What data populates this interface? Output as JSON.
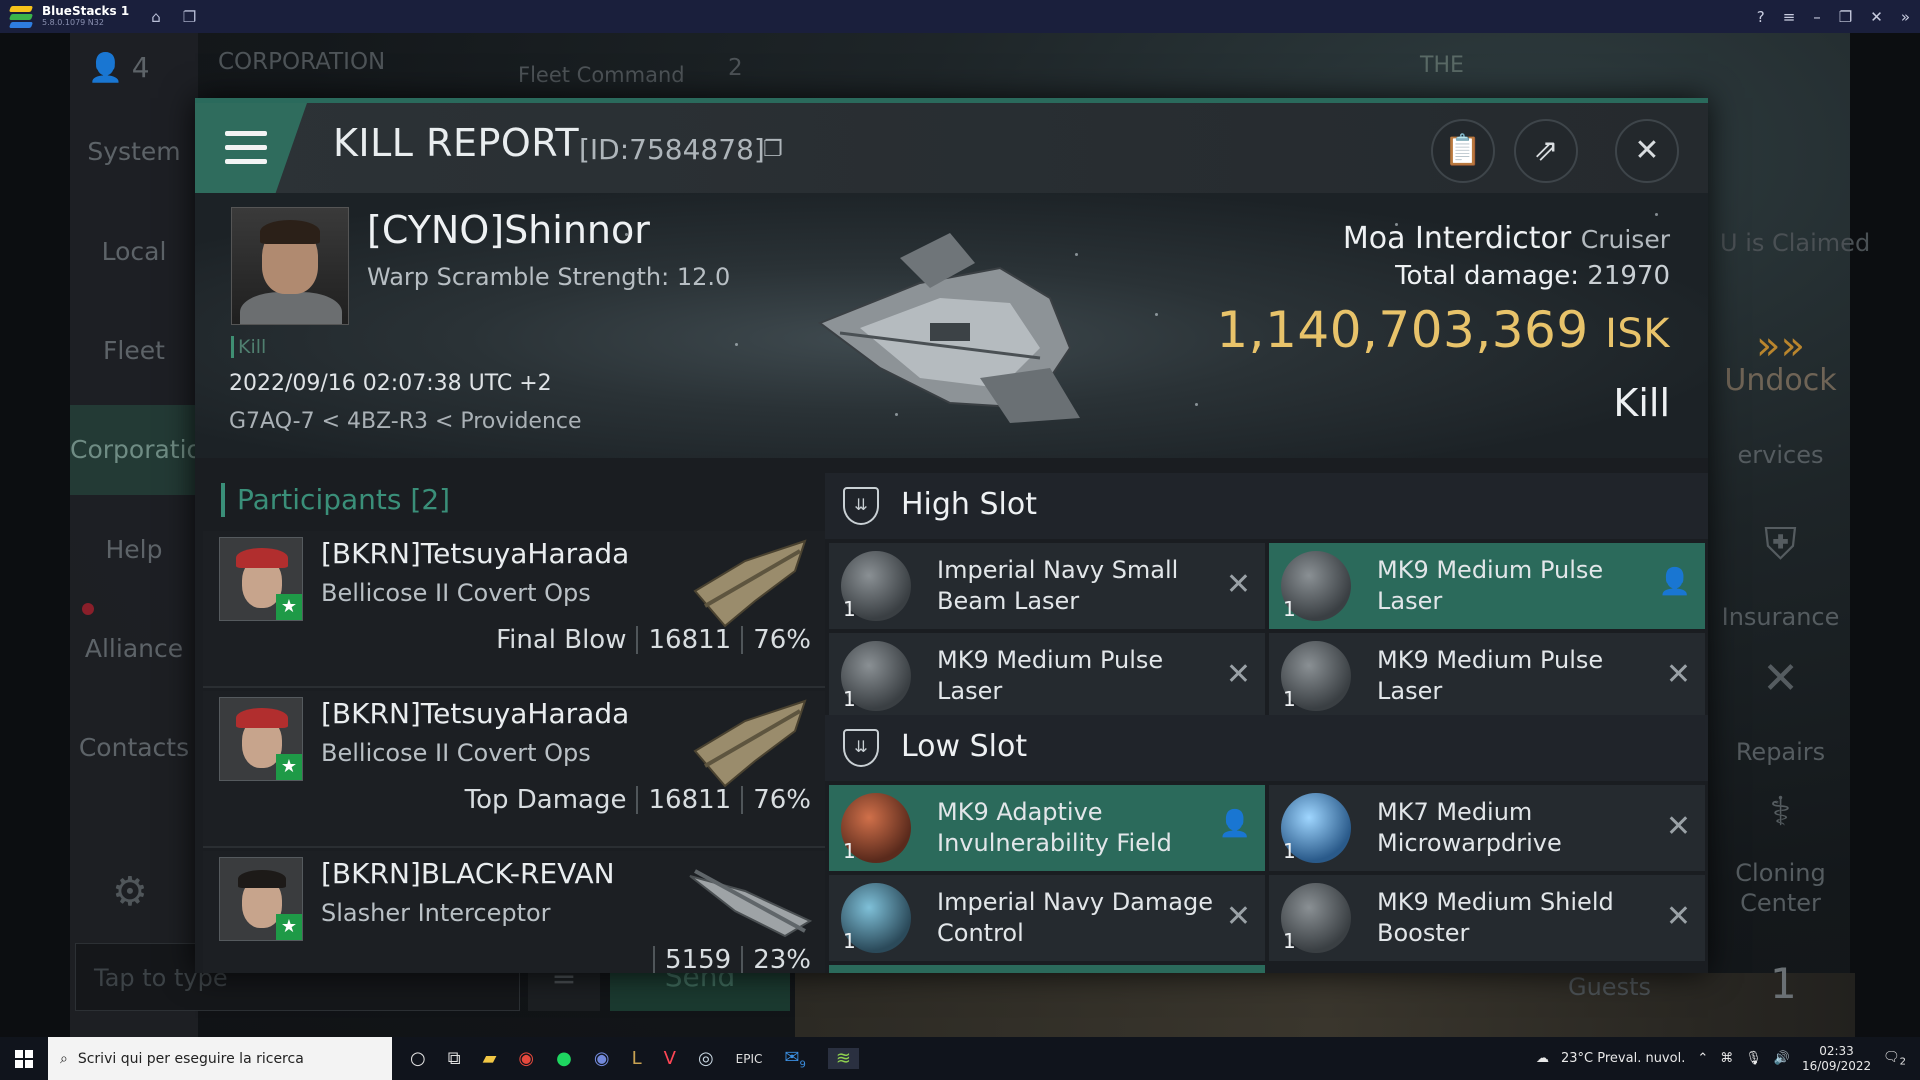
{
  "bluestacks": {
    "name": "BlueStacks 1",
    "version": "5.8.0.1079 N32"
  },
  "game": {
    "left_nav": [
      "System",
      "Local",
      "Fleet",
      "Corporation",
      "Help",
      "Alliance",
      "Contacts"
    ],
    "pilot_count": "4",
    "top_tab": "CORPORATION",
    "top_tab2": "Fleet Command",
    "top_count": "2",
    "right_text": "U is Claimed",
    "right_panel": [
      "Undock",
      "ervices",
      "Insurance",
      "Repairs",
      "Cloning Center",
      "Guests"
    ],
    "guests_count": "1",
    "chat_placeholder": "Tap to type",
    "send_label": "Send",
    "emblem_text": "THE"
  },
  "kill_report": {
    "title": "KILL REPORT",
    "id": "[ID:7584878]",
    "victim_name": "[CYNO]Shinnor",
    "warp_scramble": "Warp Scramble Strength: 12.0",
    "kill_tag": "Kill",
    "timestamp": "2022/09/16 02:07:38 UTC +2",
    "location": "G7AQ-7 < 4BZ-R3 < Providence",
    "ship_name": "Moa Interdictor",
    "ship_class": "Cruiser",
    "total_damage_label": "Total damage:",
    "total_damage": "21970",
    "isk_value": "1,140,703,369",
    "isk_unit": "ISK",
    "result": "Kill"
  },
  "participants": {
    "header": "Participants",
    "count": "[2]",
    "rows": [
      {
        "name": "[BKRN]TetsuyaHarada",
        "ship": "Bellicose II Covert Ops",
        "tag": "Final Blow",
        "damage": "16811",
        "percent": "76%"
      },
      {
        "name": "[BKRN]TetsuyaHarada",
        "ship": "Bellicose II Covert Ops",
        "tag": "Top Damage",
        "damage": "16811",
        "percent": "76%"
      },
      {
        "name": "[BKRN]BLACK-REVAN",
        "ship": "Slasher Interceptor",
        "tag": "",
        "damage": "5159",
        "percent": "23%"
      }
    ]
  },
  "high_slot": {
    "label": "High Slot",
    "items": [
      {
        "name": "Imperial Navy Small Beam Laser",
        "qty": "1",
        "status": "destroyed"
      },
      {
        "name": "MK9 Medium Pulse Laser",
        "qty": "1",
        "status": "dropped"
      },
      {
        "name": "MK9 Medium Pulse Laser",
        "qty": "1",
        "status": "destroyed"
      },
      {
        "name": "MK9 Medium Pulse Laser",
        "qty": "1",
        "status": "destroyed"
      }
    ]
  },
  "low_slot": {
    "label": "Low Slot",
    "items": [
      {
        "name": "MK9 Adaptive Invulnerability Field",
        "qty": "1",
        "status": "dropped"
      },
      {
        "name": "MK7 Medium Microwarpdrive",
        "qty": "1",
        "status": "destroyed"
      },
      {
        "name": "Imperial Navy Damage Control",
        "qty": "1",
        "status": "destroyed"
      },
      {
        "name": "MK9 Medium Shield Booster",
        "qty": "1",
        "status": "destroyed"
      }
    ]
  },
  "taskbar": {
    "search_placeholder": "Scrivi qui per eseguire la ricerca",
    "weather": "23°C Preval. nuvol.",
    "time": "02:33",
    "date": "16/09/2022",
    "notification_count": "2",
    "outlook_badge": "9"
  },
  "colors": {
    "accent": "#2f6c5d",
    "isk": "#e8c36a",
    "fitted": "#2b6a5b",
    "taskbar": "#10141c"
  }
}
